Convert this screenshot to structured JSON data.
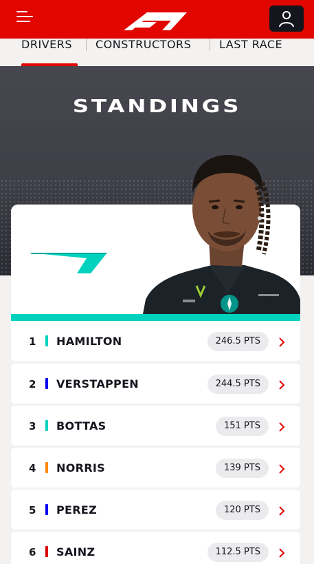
{
  "header": {
    "menu_icon": "hamburger-menu-icon",
    "logo_icon": "f1-logo",
    "account_icon": "user-icon",
    "brand_color": "#e10600"
  },
  "tabs": [
    {
      "label": "DRIVERS",
      "active": true
    },
    {
      "label": "CONSTRUCTORS",
      "active": false
    },
    {
      "label": "LAST RACE",
      "active": false
    }
  ],
  "hero": {
    "title": "STANDINGS"
  },
  "featured": {
    "team_color": "#00d2be",
    "team_logo_icon": "mercedes-arrow-logo",
    "driver_photo": "hamilton-portrait"
  },
  "standings": [
    {
      "position": "1",
      "name": "HAMILTON",
      "points": "246.5 PTS",
      "team_color": "#00d2be"
    },
    {
      "position": "2",
      "name": "VERSTAPPEN",
      "points": "244.5 PTS",
      "team_color": "#0600ef"
    },
    {
      "position": "3",
      "name": "BOTTAS",
      "points": "151 PTS",
      "team_color": "#00d2be"
    },
    {
      "position": "4",
      "name": "NORRIS",
      "points": "139 PTS",
      "team_color": "#ff8700"
    },
    {
      "position": "5",
      "name": "PEREZ",
      "points": "120 PTS",
      "team_color": "#0600ef"
    },
    {
      "position": "6",
      "name": "SAINZ",
      "points": "112.5 PTS",
      "team_color": "#dc0000"
    }
  ]
}
